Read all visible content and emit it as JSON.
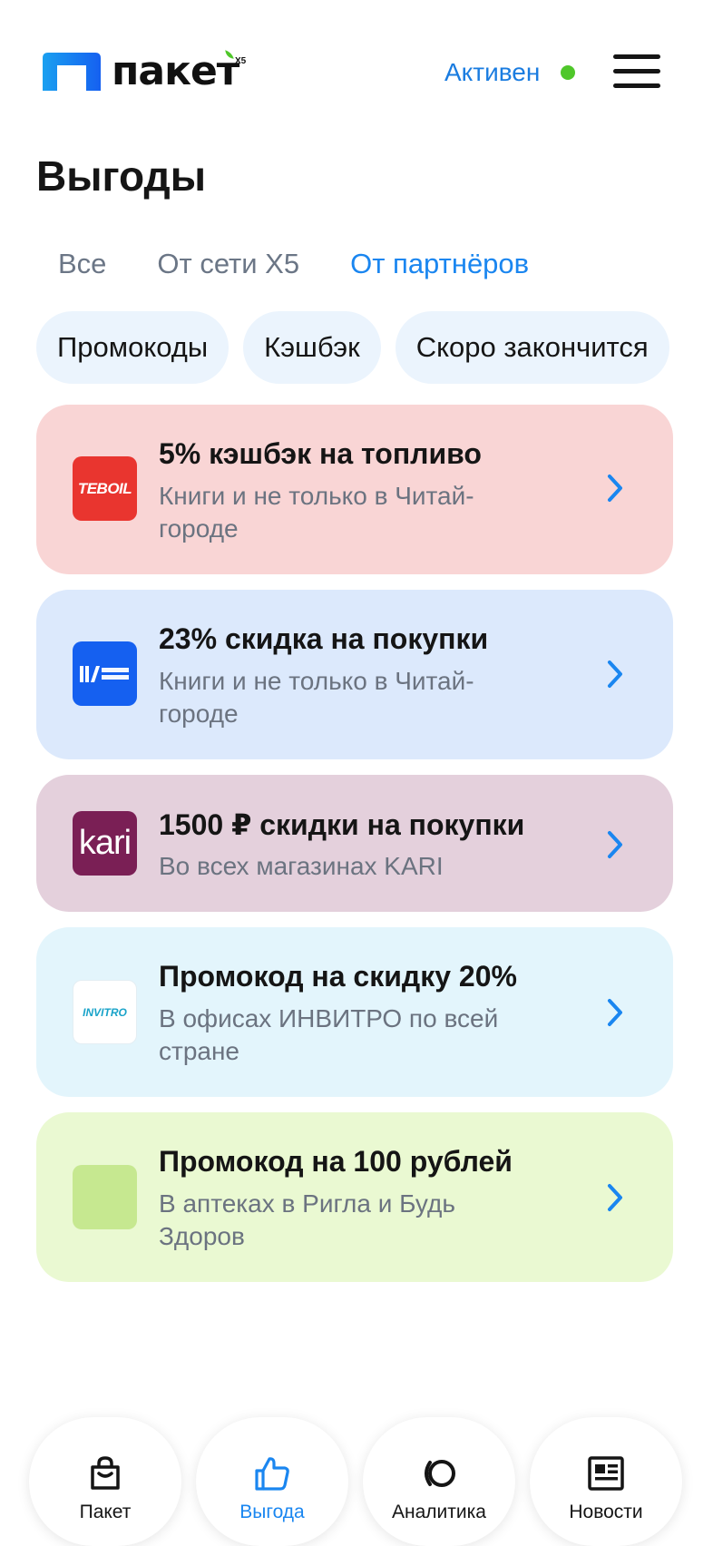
{
  "header": {
    "logo_text": "пакет",
    "logo_badge": "X5",
    "status_text": "Активен",
    "status_color": "#4fc72a",
    "menu_icon": "hamburger-menu-icon"
  },
  "page": {
    "title": "Выгоды"
  },
  "tabs": [
    {
      "label": "Все",
      "active": false
    },
    {
      "label": "От сети X5",
      "active": false
    },
    {
      "label": "От партнёров",
      "active": true
    }
  ],
  "chips": [
    {
      "label": "Промокоды"
    },
    {
      "label": "Кэшбэк"
    },
    {
      "label": "Скоро закончится"
    }
  ],
  "offers": [
    {
      "title": "5% кэшбэк на топливо",
      "subtitle": "Книги и не только в Читай-городе",
      "logo_text": "TEBOIL",
      "bg": "#f9d5d5"
    },
    {
      "title": "23% скидка на покупки",
      "subtitle": "Книги и не только в Читай-городе",
      "logo_text": "ЧИТАЙ ГОРОД",
      "bg": "#dce9fc"
    },
    {
      "title": "1500 ₽ скидки на покупки",
      "subtitle": "Во всех магазинах KARI",
      "logo_text": "kari",
      "bg": "#e4d0dc"
    },
    {
      "title": "Промокод на скидку 20%",
      "subtitle": "В офисах ИНВИТРО по всей стране",
      "logo_text": "INVITRO",
      "bg": "#e3f5fc"
    },
    {
      "title": "Промокод на 100 рублей",
      "subtitle": "В аптеках в Ригла и Будь Здоров",
      "logo_text": "",
      "bg": "#eaf9d2"
    }
  ],
  "bottom_nav": [
    {
      "label": "Пакет",
      "icon": "shopping-bag-icon",
      "active": false
    },
    {
      "label": "Выгода",
      "icon": "thumbs-up-icon",
      "active": true
    },
    {
      "label": "Аналитика",
      "icon": "analytics-icon",
      "active": false
    },
    {
      "label": "Новости",
      "icon": "news-icon",
      "active": false
    }
  ],
  "colors": {
    "accent": "#1a86f0",
    "text": "#151515",
    "muted": "#6b7686"
  }
}
